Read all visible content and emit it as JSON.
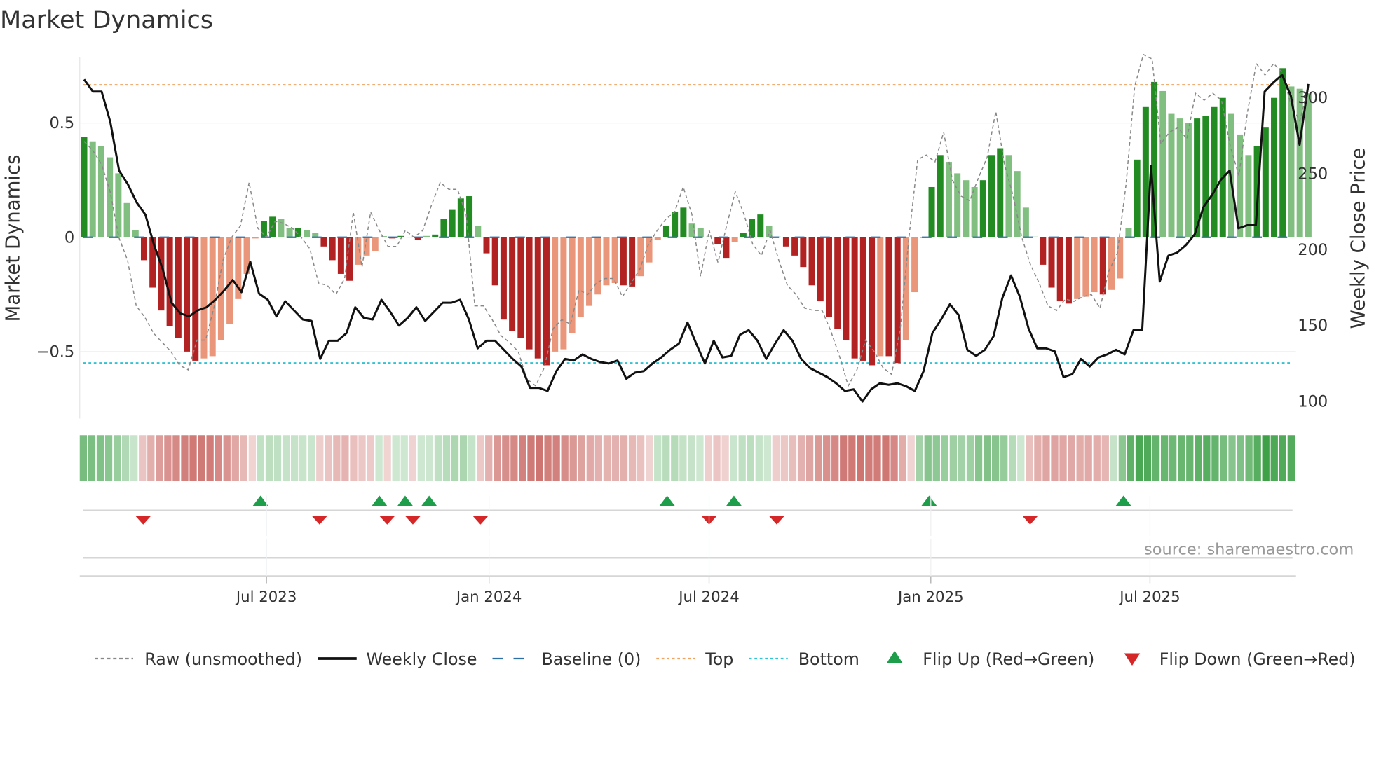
{
  "chart_data": {
    "type": "bar",
    "title": "Market Dynamics",
    "ylabel_left": "Market Dynamics",
    "ylabel_right": "Weekly Close Price",
    "ylim_left": [
      -0.8,
      0.8
    ],
    "ylim_right_ticks": [
      100,
      150,
      200,
      250,
      300
    ],
    "left_ticks": [
      {
        "value": 0.5,
        "label": "0.5"
      },
      {
        "value": 0,
        "label": "0"
      },
      {
        "value": -0.5,
        "label": "−0.5"
      }
    ],
    "top_level": 0.667,
    "bottom_level": -0.55,
    "baseline": 0,
    "x_ticks": [
      {
        "label": "Jul 2023",
        "week": 21.3
      },
      {
        "label": "Jan 2024",
        "week": 47.3
      },
      {
        "label": "Jul 2024",
        "week": 73.0
      },
      {
        "label": "Jan 2025",
        "week": 98.9
      },
      {
        "label": "Jul 2025",
        "week": 124.5
      }
    ],
    "dynamics": [
      0.44,
      0.42,
      0.4,
      0.35,
      0.28,
      0.15,
      0.03,
      -0.1,
      -0.22,
      -0.32,
      -0.39,
      -0.44,
      -0.5,
      -0.54,
      -0.53,
      -0.52,
      -0.45,
      -0.38,
      -0.27,
      -0.16,
      -0.005,
      0.07,
      0.09,
      0.08,
      0.04,
      0.04,
      0.03,
      0.02,
      -0.04,
      -0.1,
      -0.16,
      -0.19,
      -0.12,
      -0.08,
      -0.06,
      0.005,
      -0.005,
      0.006,
      0.002,
      -0.01,
      0.006,
      0.012,
      0.08,
      0.12,
      0.17,
      0.18,
      0.05,
      -0.07,
      -0.21,
      -0.36,
      -0.41,
      -0.44,
      -0.49,
      -0.53,
      -0.56,
      -0.5,
      -0.49,
      -0.42,
      -0.35,
      -0.3,
      -0.25,
      -0.21,
      -0.2,
      -0.21,
      -0.215,
      -0.17,
      -0.11,
      -0.01,
      0.05,
      0.11,
      0.13,
      0.06,
      0.04,
      0.003,
      -0.03,
      -0.09,
      -0.02,
      0.02,
      0.08,
      0.1,
      0.05,
      0.003,
      -0.04,
      -0.08,
      -0.13,
      -0.21,
      -0.28,
      -0.35,
      -0.4,
      -0.45,
      -0.53,
      -0.54,
      -0.56,
      -0.52,
      -0.52,
      -0.55,
      -0.45,
      -0.24,
      -0.003,
      0.22,
      0.36,
      0.33,
      0.28,
      0.25,
      0.22,
      0.25,
      0.36,
      0.39,
      0.36,
      0.29,
      0.13,
      0.003,
      -0.12,
      -0.22,
      -0.28,
      -0.29,
      -0.27,
      -0.26,
      -0.24,
      -0.25,
      -0.23,
      -0.18,
      0.04,
      0.34,
      0.57,
      0.68,
      0.64,
      0.54,
      0.52,
      0.5,
      0.52,
      0.53,
      0.57,
      0.61,
      0.54,
      0.45,
      0.36,
      0.4,
      0.48,
      0.61,
      0.74,
      0.66,
      0.65,
      0.63
    ],
    "raw_unsmoothed": [
      0.42,
      0.38,
      0.32,
      0.2,
      0.0,
      -0.1,
      -0.3,
      -0.35,
      -0.42,
      -0.46,
      -0.5,
      -0.56,
      -0.58,
      -0.45,
      -0.45,
      -0.3,
      -0.1,
      0.0,
      0.05,
      0.24,
      0.04,
      0.0,
      0.07,
      0.06,
      0.04,
      0.0,
      -0.05,
      -0.2,
      -0.21,
      -0.25,
      -0.18,
      0.11,
      -0.13,
      0.11,
      0.03,
      -0.04,
      -0.04,
      0.03,
      0.0,
      0.03,
      0.14,
      0.24,
      0.21,
      0.21,
      0.1,
      -0.3,
      -0.3,
      -0.36,
      -0.43,
      -0.46,
      -0.5,
      -0.62,
      -0.65,
      -0.57,
      -0.4,
      -0.36,
      -0.38,
      -0.23,
      -0.25,
      -0.2,
      -0.18,
      -0.18,
      -0.26,
      -0.2,
      -0.14,
      -0.03,
      0.03,
      0.08,
      0.11,
      0.22,
      0.1,
      -0.17,
      0.03,
      -0.11,
      0.05,
      0.2,
      0.1,
      -0.03,
      -0.08,
      0.03,
      -0.1,
      -0.21,
      -0.25,
      -0.31,
      -0.32,
      -0.32,
      -0.41,
      -0.52,
      -0.65,
      -0.58,
      -0.45,
      -0.5,
      -0.57,
      -0.6,
      -0.4,
      0.0,
      0.34,
      0.36,
      0.33,
      0.46,
      0.25,
      0.18,
      0.16,
      0.26,
      0.35,
      0.55,
      0.32,
      0.18,
      0.0,
      -0.12,
      -0.2,
      -0.3,
      -0.32,
      -0.27,
      -0.28,
      -0.26,
      -0.25,
      -0.31,
      -0.15,
      -0.07,
      0.23,
      0.66,
      0.8,
      0.78,
      0.41,
      0.46,
      0.48,
      0.43,
      0.63,
      0.6,
      0.63,
      0.6,
      0.4,
      0.27,
      0.55,
      0.76,
      0.71,
      0.76,
      0.72,
      0.58,
      0.51,
      0.65
    ],
    "weekly_close": [
      312,
      304,
      304,
      284,
      252,
      243,
      231,
      223,
      203,
      187,
      165,
      158,
      156,
      160,
      162,
      167,
      173,
      180,
      172,
      192,
      171,
      167,
      156,
      166,
      160,
      154,
      153,
      128,
      140,
      140,
      145,
      162,
      155,
      154,
      167,
      159,
      150,
      155,
      162,
      153,
      159,
      165,
      165,
      167,
      154,
      135,
      140,
      140,
      134,
      128,
      123,
      109,
      109,
      107,
      120,
      128,
      127,
      131,
      128,
      126,
      125,
      127,
      115,
      119,
      120,
      125,
      129,
      134,
      138,
      152,
      138,
      125,
      140,
      129,
      130,
      144,
      147,
      140,
      128,
      138,
      147,
      140,
      128,
      122,
      119,
      116,
      112,
      107,
      108,
      100,
      108,
      112,
      111,
      112,
      110,
      107,
      120,
      145,
      154,
      164,
      157,
      134,
      130,
      134,
      143,
      168,
      183,
      169,
      148,
      135,
      135,
      133,
      116,
      118,
      128,
      123,
      129,
      131,
      134,
      131,
      147,
      147,
      255,
      179,
      196,
      198,
      203,
      210,
      228,
      236,
      246,
      252,
      214,
      216,
      216,
      304,
      310,
      315,
      301,
      269,
      309
    ],
    "flip_up_weeks": [
      20.6,
      34.5,
      37.5,
      40.3,
      68.1,
      75.9,
      98.7,
      121.4
    ],
    "flip_down_weeks": [
      6.9,
      27.5,
      35.4,
      38.4,
      46.3,
      73.0,
      80.9,
      110.5
    ],
    "legend": [
      {
        "label": "Raw (unsmoothed)",
        "style": "dashed",
        "color": "#888888"
      },
      {
        "label": "Weekly Close",
        "style": "solid",
        "color": "#111111"
      },
      {
        "label": "Baseline (0)",
        "style": "dashed",
        "color": "#2c6fa5"
      },
      {
        "label": "Top",
        "style": "dotted",
        "color": "#f0a35e"
      },
      {
        "label": "Bottom",
        "style": "dotted",
        "color": "#2ec4d4"
      },
      {
        "label": "Flip Up (Red→Green)",
        "style": "triangle-up",
        "color": "#1e9e4a"
      },
      {
        "label": "Flip Down (Green→Red)",
        "style": "triangle-down",
        "color": "#d62728"
      }
    ],
    "legend_placement": "bottom",
    "colors": {
      "green_strong": "#228b22",
      "green_weak": "#80bf80",
      "red_strong": "#b22222",
      "red_weak": "#e9967a"
    }
  },
  "source": "source: sharemaestro.com"
}
